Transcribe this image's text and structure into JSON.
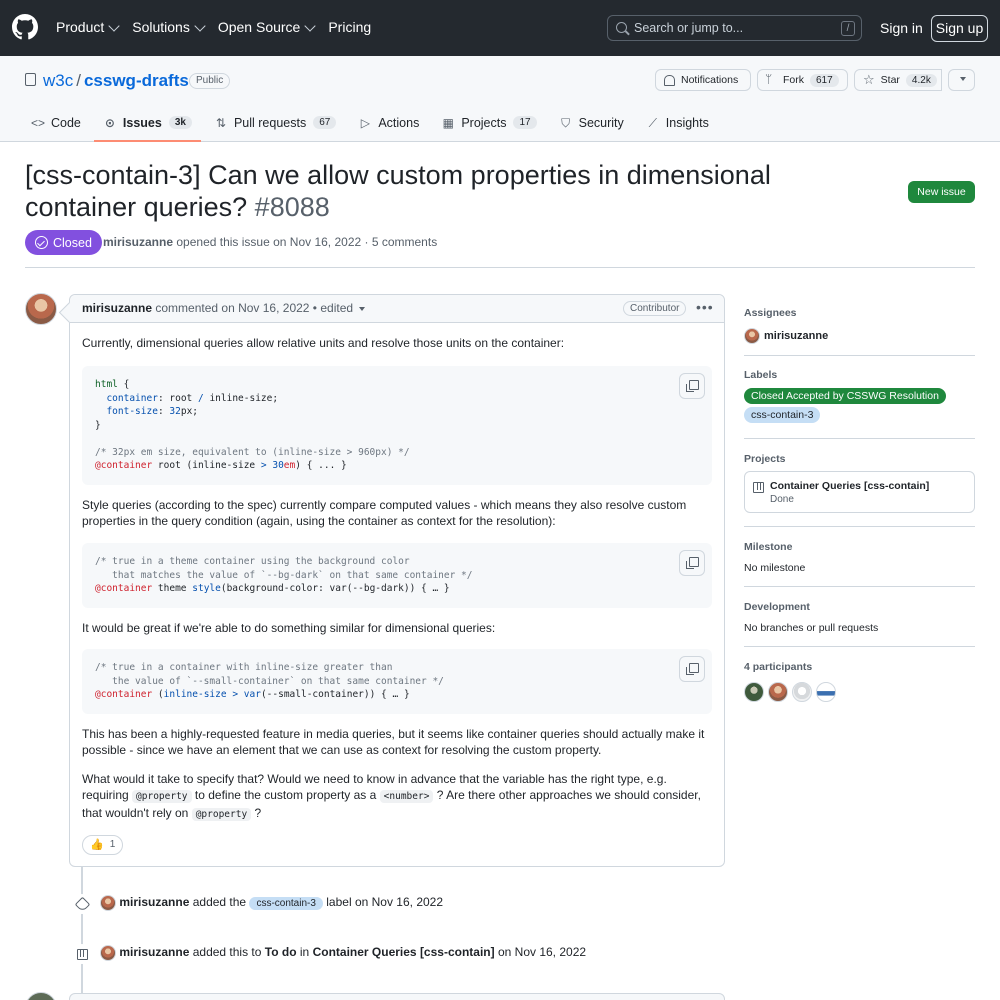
{
  "header": {
    "nav": [
      {
        "label": "Product"
      },
      {
        "label": "Solutions"
      },
      {
        "label": "Open Source"
      },
      {
        "label": "Pricing"
      }
    ],
    "search_placeholder": "Search or jump to...",
    "search_key": "/",
    "signin_label": "Sign in",
    "signup_label": "Sign up"
  },
  "repo": {
    "owner": "w3c",
    "separator": "/",
    "name": "csswg-drafts",
    "visibility": "Public",
    "notifications_label": "Notifications",
    "fork_label": "Fork",
    "fork_count": "617",
    "star_label": "Star",
    "star_count": "4.2k",
    "tabs": [
      {
        "label": "Code",
        "icon": "code-icon"
      },
      {
        "label": "Issues",
        "count": "3k",
        "icon": "issue-icon",
        "active": true
      },
      {
        "label": "Pull requests",
        "count": "67",
        "icon": "pull-request-icon"
      },
      {
        "label": "Actions",
        "icon": "play-icon"
      },
      {
        "label": "Projects",
        "count": "17",
        "icon": "table-icon"
      },
      {
        "label": "Security",
        "icon": "shield-icon"
      },
      {
        "label": "Insights",
        "icon": "graph-icon"
      }
    ]
  },
  "issue": {
    "title": "[css-contain-3] Can we allow custom properties in dimensional container queries?",
    "number": "#8088",
    "state": "Closed",
    "author": "mirisuzanne",
    "opened_text": "opened this issue on Nov 16, 2022 · 5 comments",
    "new_issue_label": "New issue"
  },
  "comment": {
    "author": "mirisuzanne",
    "meta": "commented on Nov 16, 2022 • edited",
    "role_badge": "Contributor",
    "p1": "Currently, dimensional queries allow relative units and resolve those units on the container:",
    "p2": "Style queries (according to the spec) currently compare computed values - which means they also resolve custom properties in the query condition (again, using the container as context for the resolution):",
    "p3": "It would be great if we're able to do something similar for dimensional queries:",
    "p4": "This has been a highly-requested feature in media queries, but it seems like container queries should actually make it possible - since we have an element that we can use as context for resolving the custom property.",
    "p5_a": "What would it take to specify that? Would we need to know in advance that the variable has the right type, e.g. requiring",
    "p5_code1": "@property",
    "p5_b": "to define the custom property as a",
    "p5_code2": "<number>",
    "p5_c": "? Are there other approaches we should consider, that wouldn't rely on",
    "p5_code3": "@property",
    "p5_d": "?",
    "reaction_emoji": "👍",
    "reaction_count": "1"
  },
  "events": [
    {
      "actor": "mirisuzanne",
      "verb": "added the",
      "label": "css-contain-3",
      "suffix": "label on Nov 16, 2022"
    },
    {
      "actor": "mirisuzanne",
      "verb": "added this to",
      "column": "To do",
      "middle": "in",
      "project": "Container Queries [css-contain]",
      "suffix": "on Nov 16, 2022"
    }
  ],
  "sidebar": {
    "assignees_heading": "Assignees",
    "assignee": "mirisuzanne",
    "labels_heading": "Labels",
    "labels": [
      {
        "name": "Closed Accepted by CSSWG Resolution",
        "color": "#1f883d",
        "text_color": "#ffffff"
      },
      {
        "name": "css-contain-3",
        "color": "#c5def5",
        "text_color": "#1f2328"
      }
    ],
    "projects_heading": "Projects",
    "project_name": "Container Queries [css-contain]",
    "project_status": "Done",
    "milestone_heading": "Milestone",
    "milestone_value": "No milestone",
    "development_heading": "Development",
    "development_value": "No branches or pull requests",
    "participants_heading": "4 participants"
  },
  "colors": {
    "header_bg": "#24292f",
    "closed_purple": "#8250df",
    "new_issue_green": "#1f883d",
    "link_blue": "#0969da"
  }
}
